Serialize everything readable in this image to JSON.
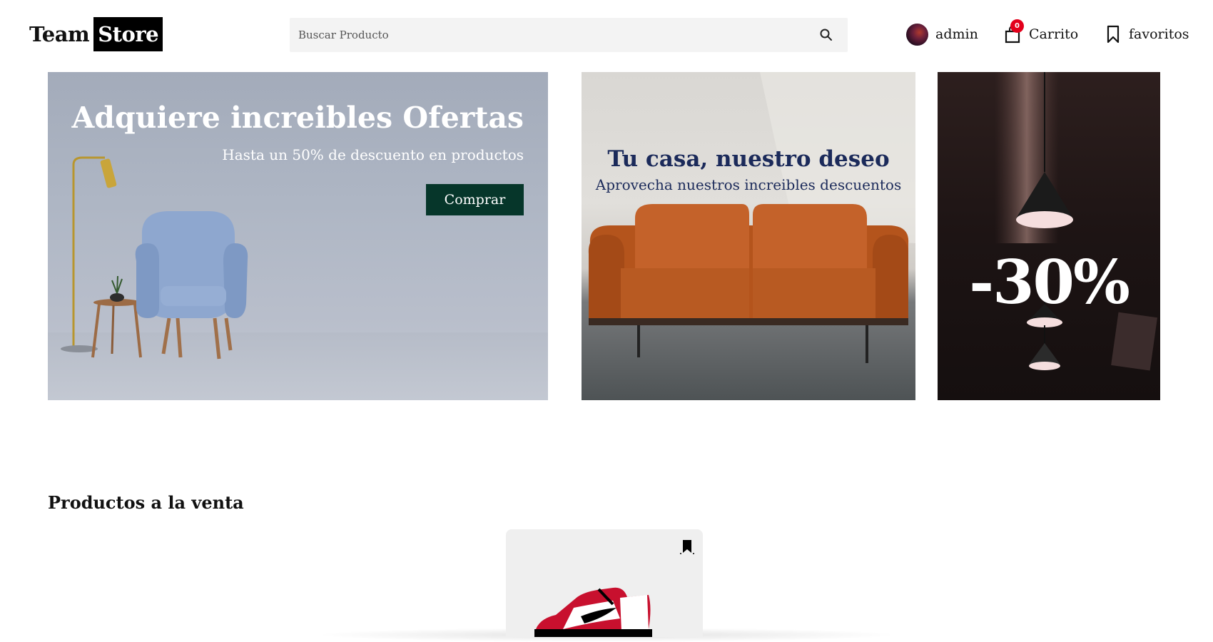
{
  "header": {
    "logo_team": "Team",
    "logo_store": "Store",
    "search_placeholder": "Buscar Producto",
    "user_label": "admin",
    "cart_label": "Carrito",
    "cart_count": "0",
    "favorites_label": "favoritos"
  },
  "banners": {
    "main": {
      "title": "Adquiere increibles Ofertas",
      "subtitle": "Hasta un 50% de descuento en productos",
      "button_label": "Comprar"
    },
    "middle": {
      "title": "Tu casa, nuestro deseo",
      "subtitle": "Aprovecha nuestros increibles descuentos"
    },
    "right": {
      "discount": "-30%"
    }
  },
  "products": {
    "section_title": "Productos a la venta"
  },
  "colors": {
    "button_green": "#06362a",
    "badge_red": "#e3001b",
    "headline_navy": "#1b2a5a"
  }
}
